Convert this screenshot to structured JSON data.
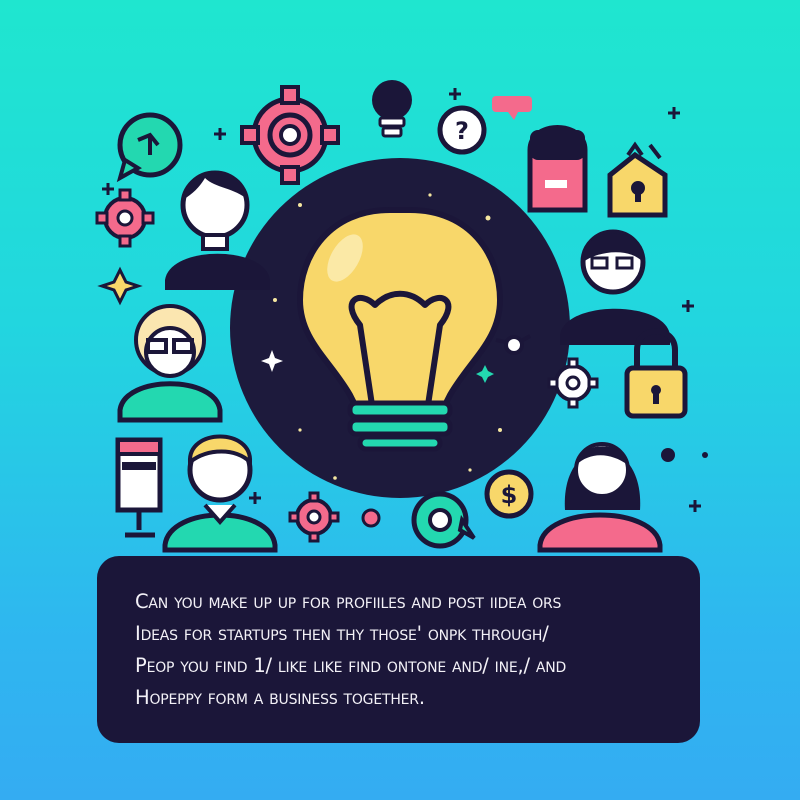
{
  "caption": {
    "lines": [
      "Can you make up up for profiiles and post iidea ors",
      "ideas for startups Then thy those' onpk through/",
      "peop you find 1/ like like find ontone and/ ine,/ and",
      "Hopeppy form a business together."
    ]
  },
  "icons": {
    "dollar_symbol": "$"
  },
  "colors": {
    "background_top": "#1fe6cf",
    "background_bottom": "#34acf2",
    "dark": "#1b1639",
    "bulb": "#f8d76a",
    "pink": "#f46a8c",
    "teal": "#23d8b0"
  }
}
